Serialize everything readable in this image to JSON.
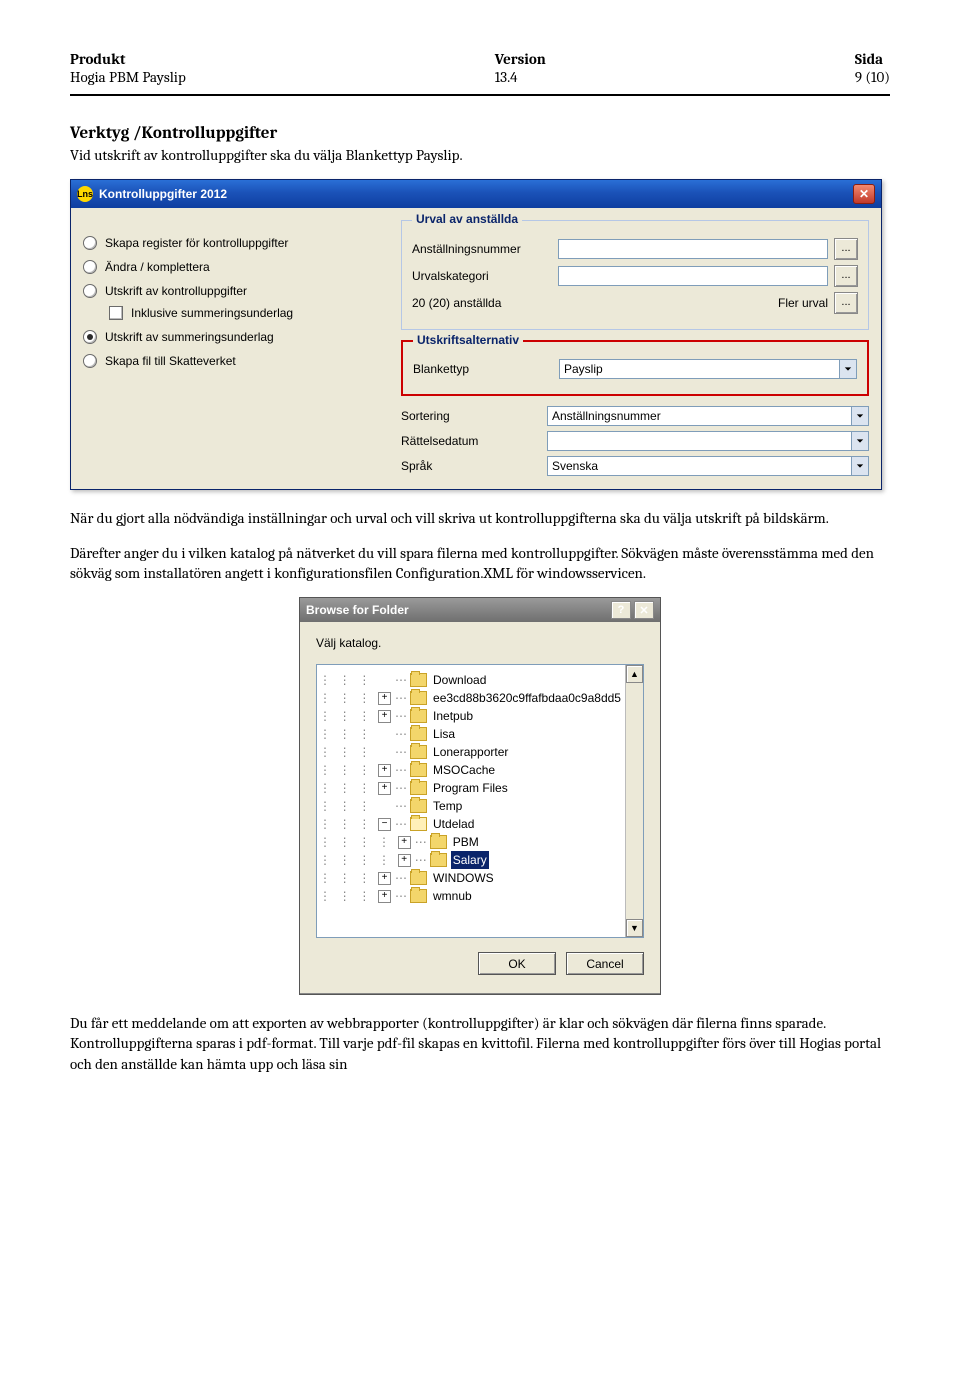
{
  "header": {
    "col1_label": "Produkt",
    "col1_value": "Hogia PBM Payslip",
    "col2_label": "Version",
    "col2_value": "13.4",
    "col3_label": "Sida",
    "col3_value": "9 (10)"
  },
  "section_title": "Verktyg /Kontrolluppgifter",
  "intro": "Vid utskrift av kontrolluppgifter ska du välja Blankettyp Payslip.",
  "dialog1": {
    "title": "Kontrolluppgifter 2012",
    "app_icon": "Lns",
    "radios": [
      {
        "label": "Skapa register för kontrolluppgifter",
        "checked": false
      },
      {
        "label": "Ändra / komplettera",
        "checked": false
      },
      {
        "label": "Utskrift av kontrolluppgifter",
        "checked": false
      },
      {
        "label": "Utskrift av summeringsunderlag",
        "checked": true
      },
      {
        "label": "Skapa fil till Skatteverket",
        "checked": false
      }
    ],
    "checkbox_label": "Inklusive summeringsunderlag",
    "group1_legend": "Urval av anställda",
    "g1_row1": "Anställningsnummer",
    "g1_row2": "Urvalskategori",
    "g1_row3": "20 (20) anställda",
    "g1_fler": "Fler urval",
    "btn_ellipsis": "...",
    "group2_legend": "Utskriftsalternativ",
    "g2_labels": {
      "blankettyp": "Blankettyp",
      "sortering": "Sortering",
      "rattelse": "Rättelsedatum",
      "sprak": "Språk"
    },
    "g2_values": {
      "blankettyp": "Payslip",
      "sortering": "Anställningsnummer",
      "rattelse": "",
      "sprak": "Svenska"
    }
  },
  "para1": "När du gjort alla nödvändiga inställningar och urval och vill skriva ut kontrolluppgifterna ska du välja utskrift på bildskärm.",
  "para2": "Därefter anger du i vilken katalog på nätverket du vill spara filerna med kontrolluppgifter. Sökvägen måste överensstämma med den sökväg som installatören angett i konfigurationsfilen Configuration.XML för windowsservicen.",
  "browse": {
    "title": "Browse for Folder",
    "prompt": "Välj katalog.",
    "items": [
      {
        "indent": 3,
        "exp": "",
        "label": "Download"
      },
      {
        "indent": 3,
        "exp": "+",
        "label": "ee3cd88b3620c9ffafbdaa0c9a8dd5"
      },
      {
        "indent": 3,
        "exp": "+",
        "label": "Inetpub"
      },
      {
        "indent": 3,
        "exp": "",
        "label": "Lisa"
      },
      {
        "indent": 3,
        "exp": "",
        "label": "Lonerapporter"
      },
      {
        "indent": 3,
        "exp": "+",
        "label": "MSOCache"
      },
      {
        "indent": 3,
        "exp": "+",
        "label": "Program Files"
      },
      {
        "indent": 3,
        "exp": "",
        "label": "Temp"
      },
      {
        "indent": 3,
        "exp": "-",
        "label": "Utdelad",
        "open": true
      },
      {
        "indent": 4,
        "exp": "+",
        "label": "PBM"
      },
      {
        "indent": 4,
        "exp": "+",
        "label": "Salary",
        "selected": true
      },
      {
        "indent": 3,
        "exp": "+",
        "label": "WINDOWS"
      },
      {
        "indent": 3,
        "exp": "+",
        "label": "wmnub"
      }
    ],
    "ok": "OK",
    "cancel": "Cancel"
  },
  "para3": "Du får ett meddelande om att exporten av webbrapporter (kontrolluppgifter) är klar och sökvägen där filerna finns sparade. Kontrolluppgifterna sparas i pdf-format. Till varje pdf-fil skapas en kvittofil. Filerna med kontrolluppgifter förs över till Hogias portal och den anställde kan hämta upp och läsa sin"
}
